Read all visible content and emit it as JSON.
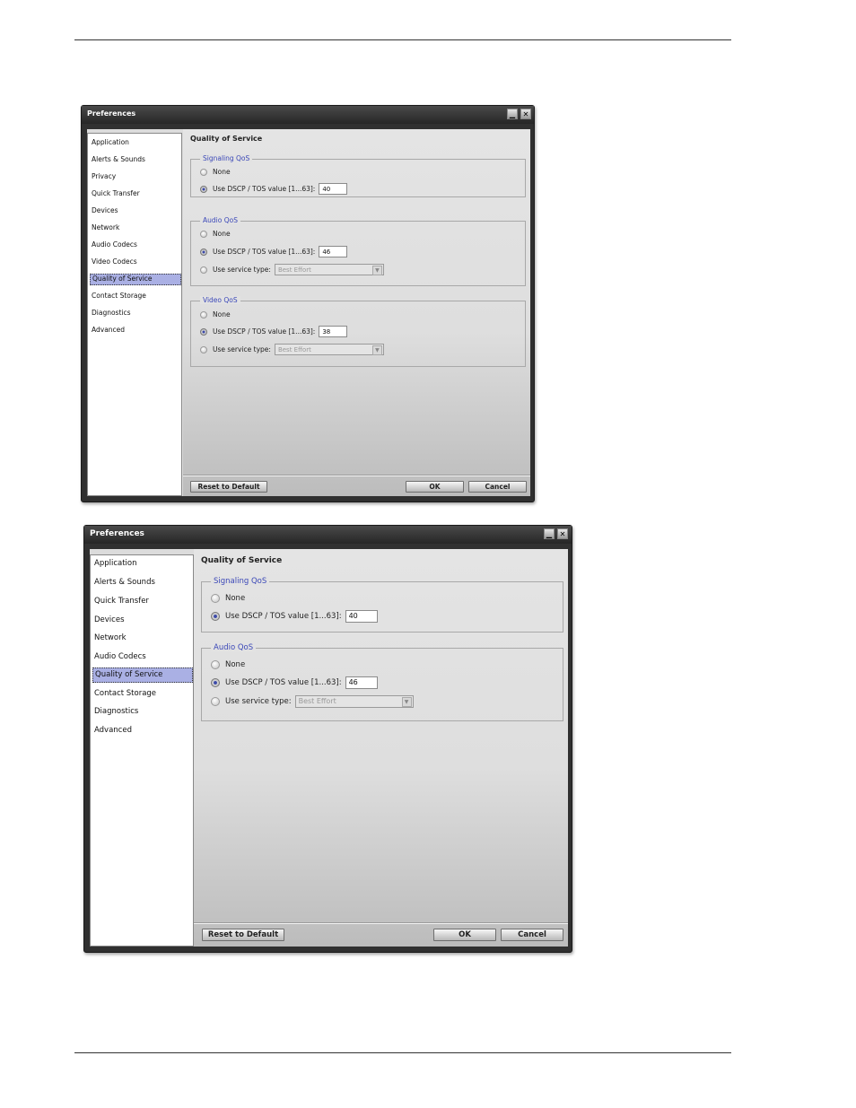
{
  "window1": {
    "title": "Preferences",
    "sidebar": [
      "Application",
      "Alerts & Sounds",
      "Privacy",
      "Quick Transfer",
      "Devices",
      "Network",
      "Audio Codecs",
      "Video Codecs",
      "Quality of Service",
      "Contact Storage",
      "Diagnostics",
      "Advanced"
    ],
    "selected": "Quality of Service",
    "section_title": "Quality of Service",
    "signaling": {
      "legend": "Signaling QoS",
      "none": "None",
      "dscp_label": "Use DSCP / TOS value [1...63]:",
      "dscp_value": "40"
    },
    "audio": {
      "legend": "Audio QoS",
      "none": "None",
      "dscp_label": "Use DSCP / TOS value [1...63]:",
      "dscp_value": "46",
      "service_label": "Use service type:",
      "service_value": "Best Effort"
    },
    "video": {
      "legend": "Video QoS",
      "none": "None",
      "dscp_label": "Use DSCP / TOS value [1...63]:",
      "dscp_value": "38",
      "service_label": "Use service type:",
      "service_value": "Best Effort"
    },
    "buttons": {
      "reset": "Reset to Default",
      "ok": "OK",
      "cancel": "Cancel"
    }
  },
  "window2": {
    "title": "Preferences",
    "sidebar": [
      "Application",
      "Alerts & Sounds",
      "Quick Transfer",
      "Devices",
      "Network",
      "Audio Codecs",
      "Quality of Service",
      "Contact Storage",
      "Diagnostics",
      "Advanced"
    ],
    "selected": "Quality of Service",
    "section_title": "Quality of Service",
    "signaling": {
      "legend": "Signaling QoS",
      "none": "None",
      "dscp_label": "Use DSCP / TOS value [1...63]:",
      "dscp_value": "40"
    },
    "audio": {
      "legend": "Audio QoS",
      "none": "None",
      "dscp_label": "Use DSCP / TOS value [1...63]:",
      "dscp_value": "46",
      "service_label": "Use service type:",
      "service_value": "Best Effort"
    },
    "buttons": {
      "reset": "Reset to Default",
      "ok": "OK",
      "cancel": "Cancel"
    }
  },
  "icons": {
    "minimize": "minimize-icon",
    "close": "close-icon",
    "dropdown": "chevron-down-icon"
  }
}
